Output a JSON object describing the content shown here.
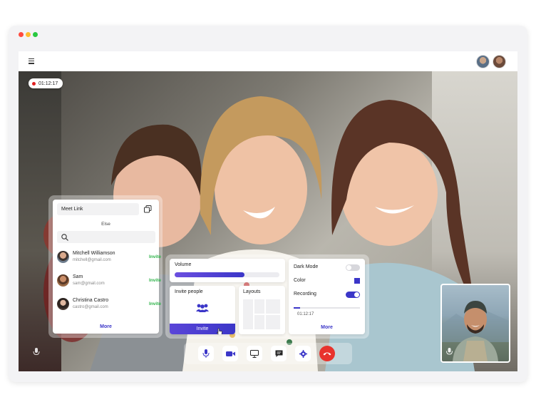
{
  "recording_badge": {
    "time": "01:12:17"
  },
  "meet_panel": {
    "meet_link_label": "Meet Link",
    "else_label": "Else",
    "search_placeholder": "",
    "people": [
      {
        "name": "Mitchell Williamson",
        "email": "mitchell@gmail.com",
        "invite_label": "Invite"
      },
      {
        "name": "Sam",
        "email": "sam@gmail.com",
        "invite_label": "Invite"
      },
      {
        "name": "Christina Castro",
        "email": "castro@gmail.com",
        "invite_label": "Invite"
      }
    ],
    "more_label": "More"
  },
  "volume_card": {
    "label": "Volume",
    "level": 0.67
  },
  "invite_card": {
    "label": "Invite people",
    "button_label": "Invite"
  },
  "layouts_card": {
    "label": "Layouts"
  },
  "settings_card": {
    "dark_mode_label": "Dark Mode",
    "dark_mode_on": false,
    "color_label": "Color",
    "color_value": "#3b36c8",
    "recording_label": "Recording",
    "recording_on": true,
    "recording_time": "01:12:17",
    "recording_progress": 0.1,
    "more_label": "More"
  },
  "controls": [
    "mic-icon",
    "camera-icon",
    "screen-share-icon",
    "chat-icon",
    "gear-icon",
    "end-call-icon"
  ],
  "colors": {
    "accent": "#3b36c8",
    "end_call": "#e8332d",
    "invite_green": "#2fb34a"
  }
}
